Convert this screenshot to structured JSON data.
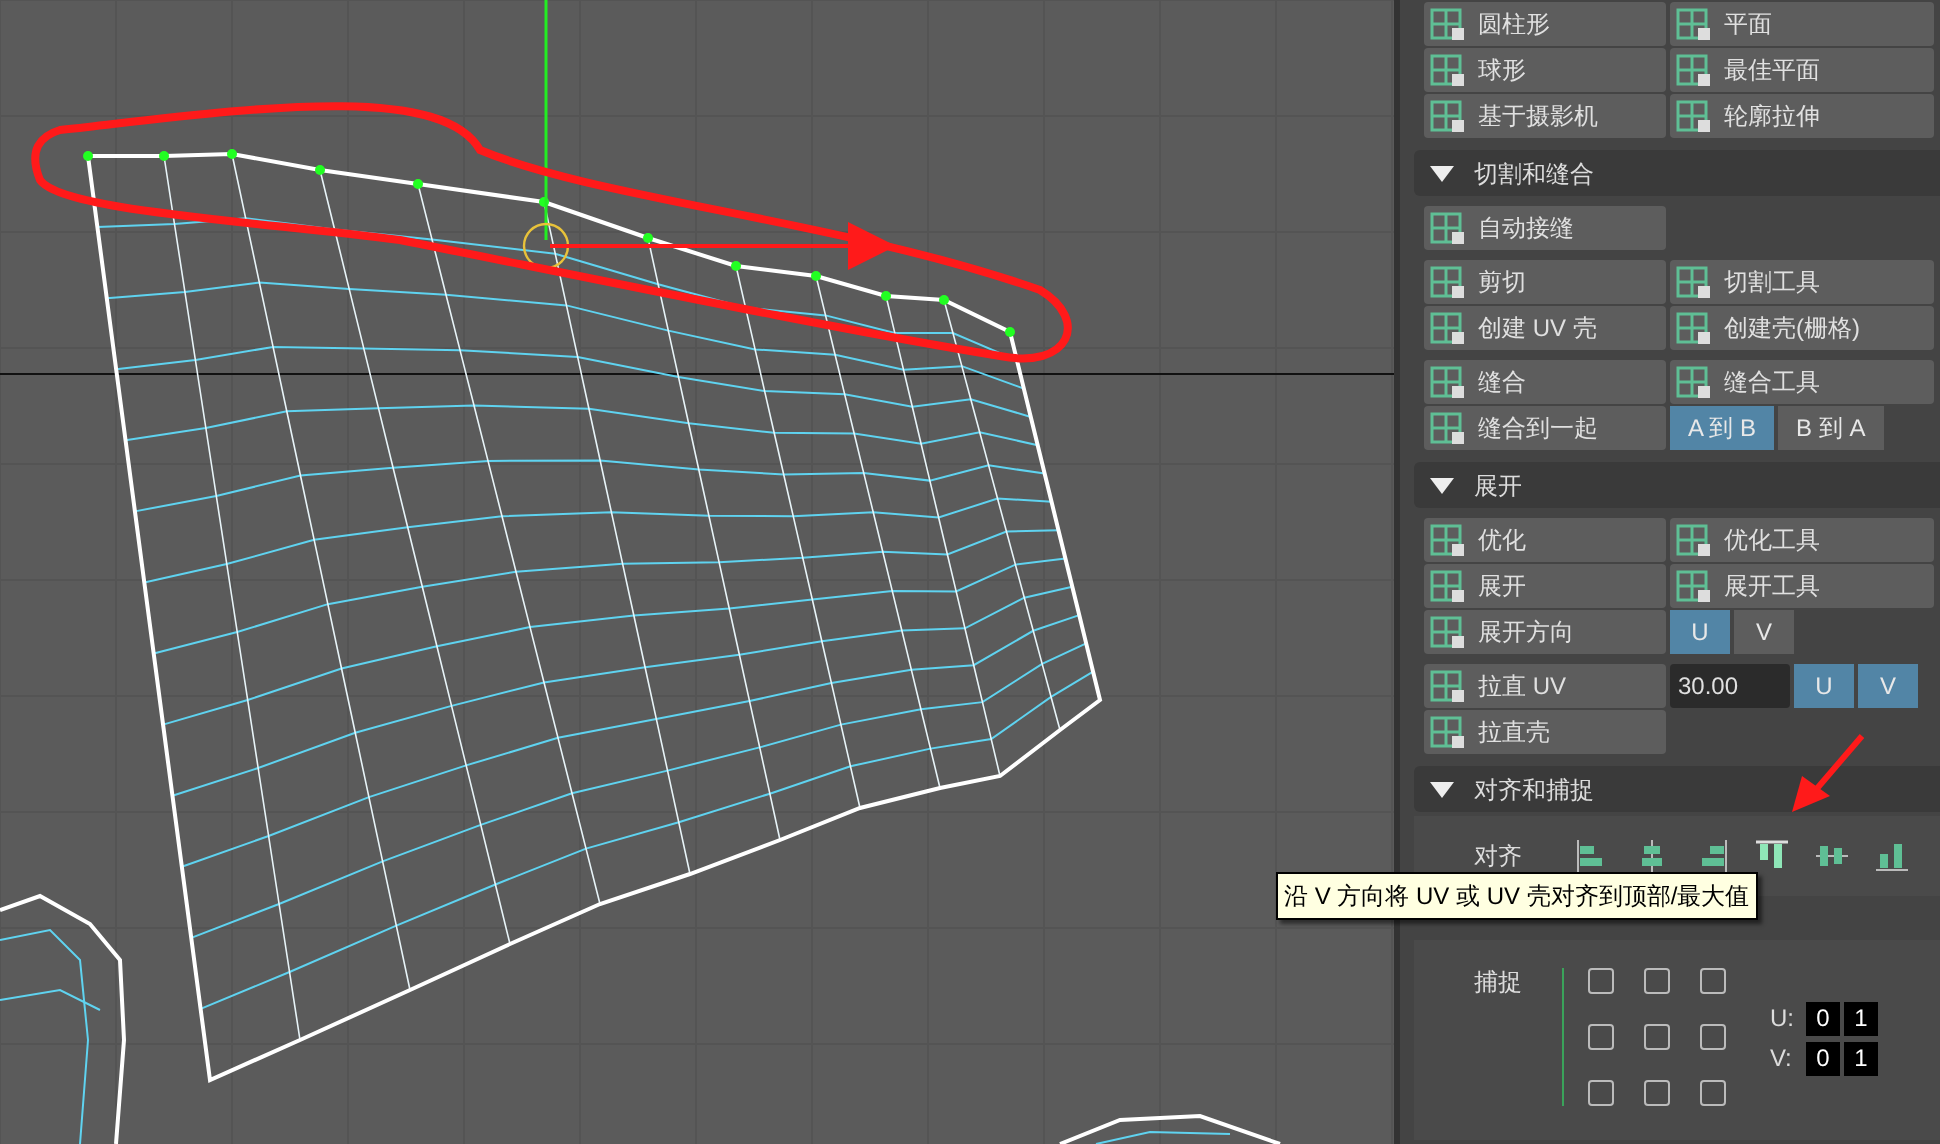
{
  "panel": {
    "projection_rows": [
      [
        {
          "kind": "tool",
          "label": "圆柱形"
        },
        {
          "kind": "tool",
          "label": "平面"
        }
      ],
      [
        {
          "kind": "tool",
          "label": "球形"
        },
        {
          "kind": "tool",
          "label": "最佳平面"
        }
      ],
      [
        {
          "kind": "tool",
          "label": "基于摄影机"
        },
        {
          "kind": "tool",
          "label": "轮廓拉伸"
        }
      ]
    ],
    "sections": [
      {
        "title": "切割和缝合",
        "expanded": true,
        "groups": [
          [
            [
              {
                "kind": "tool",
                "label": "自动接缝"
              }
            ]
          ],
          [
            [
              {
                "kind": "tool",
                "label": "剪切"
              },
              {
                "kind": "tool",
                "label": "切割工具"
              }
            ],
            [
              {
                "kind": "tool",
                "label": "创建 UV 壳"
              },
              {
                "kind": "tool",
                "label": "创建壳(栅格)"
              }
            ]
          ],
          [
            [
              {
                "kind": "tool",
                "label": "缝合"
              },
              {
                "kind": "tool",
                "label": "缝合工具"
              }
            ],
            [
              {
                "kind": "tool",
                "label": "缝合到一起"
              },
              {
                "kind": "toggle",
                "label": "A 到 B",
                "selected": true
              },
              {
                "kind": "toggle",
                "label": "B 到 A",
                "selected": false
              }
            ]
          ]
        ]
      },
      {
        "title": "展开",
        "expanded": true,
        "groups": [
          [
            [
              {
                "kind": "tool",
                "label": "优化"
              },
              {
                "kind": "tool",
                "label": "优化工具"
              }
            ],
            [
              {
                "kind": "tool",
                "label": "展开"
              },
              {
                "kind": "tool",
                "label": "展开工具"
              }
            ],
            [
              {
                "kind": "tool",
                "label": "展开方向"
              },
              {
                "kind": "toggle",
                "label": "U",
                "selected": true
              },
              {
                "kind": "toggle",
                "label": "V",
                "selected": false
              }
            ]
          ],
          [
            [
              {
                "kind": "tool",
                "label": "拉直 UV"
              },
              {
                "kind": "field",
                "value": "30.00"
              },
              {
                "kind": "toggle",
                "label": "U",
                "selected": true
              },
              {
                "kind": "toggle",
                "label": "V",
                "selected": true
              }
            ],
            [
              {
                "kind": "tool",
                "label": "拉直壳"
              }
            ]
          ]
        ]
      },
      {
        "title": "对齐和捕捉",
        "expanded": true
      }
    ],
    "align": {
      "label": "对齐",
      "icons": [
        {
          "selected": false
        },
        {
          "selected": false
        },
        {
          "selected": false
        },
        {
          "selected": true
        },
        {
          "selected": false
        },
        {
          "selected": false
        }
      ]
    },
    "tooltip": "沿 V 方向将 UV 或 UV 壳对齐到顶部/最大值",
    "snap": {
      "label": "捕捉",
      "checkboxes": [
        {
          "checked": false
        },
        {
          "checked": false
        },
        {
          "checked": false
        },
        {
          "checked": false
        },
        {
          "checked": false
        },
        {
          "checked": false
        },
        {
          "checked": false
        },
        {
          "checked": false
        },
        {
          "checked": false
        }
      ],
      "u_label": "U:",
      "u_values": [
        "0",
        "1"
      ],
      "v_label": "V:",
      "v_values": [
        "0",
        "1"
      ]
    }
  }
}
